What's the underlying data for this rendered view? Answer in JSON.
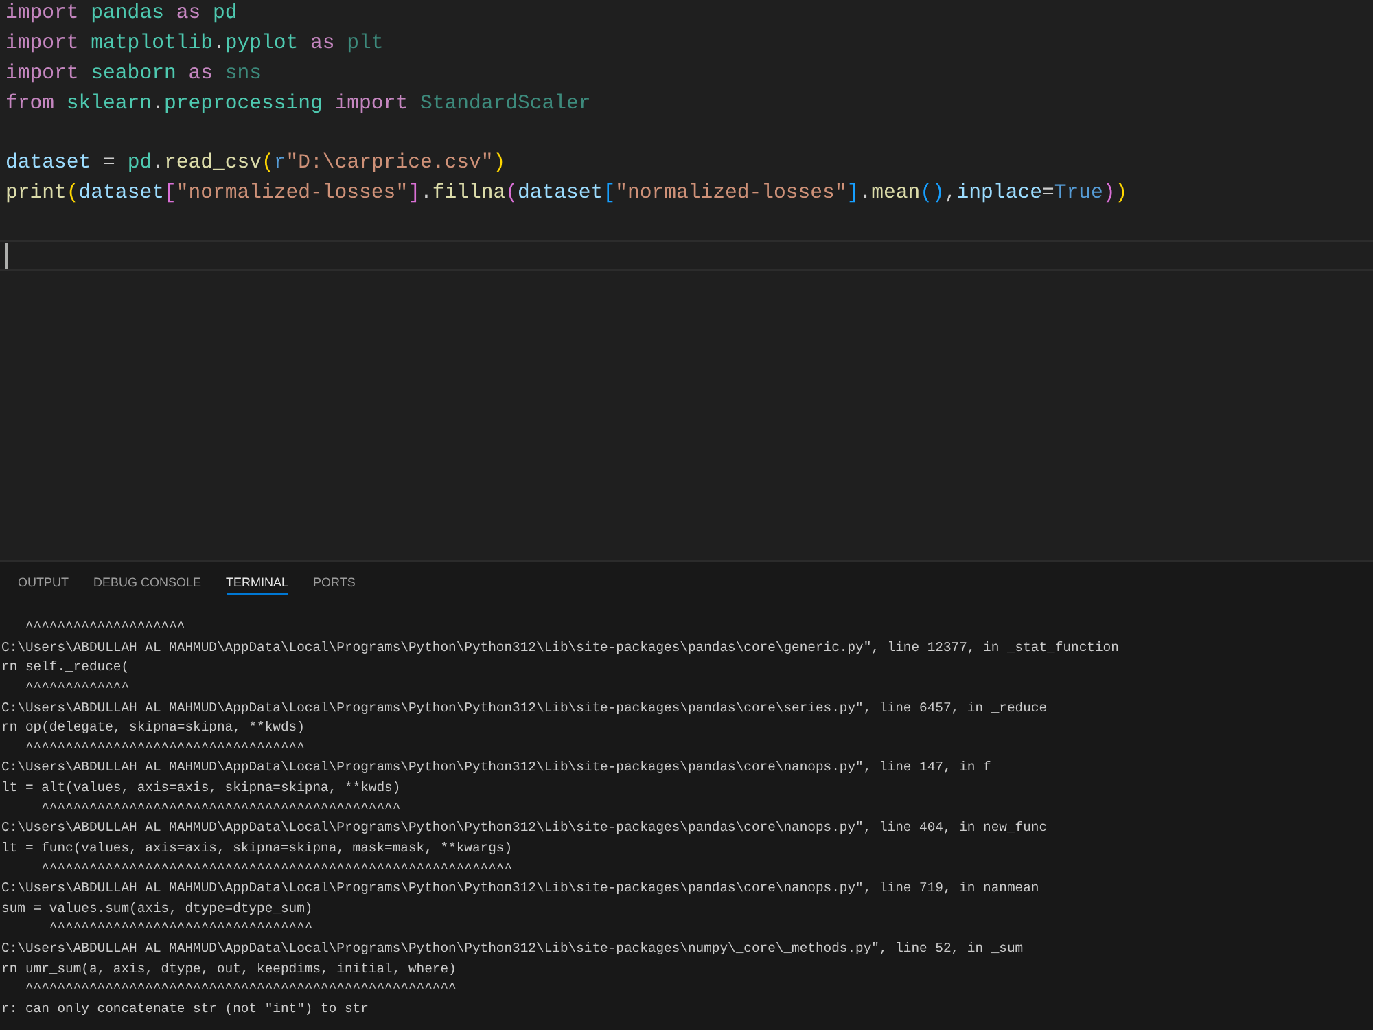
{
  "editor": {
    "lines": [
      {
        "kind": "code",
        "tokens": [
          {
            "kind": "keyword",
            "text": "import "
          },
          {
            "kind": "module",
            "text": "pandas "
          },
          {
            "kind": "keyword",
            "text": "as "
          },
          {
            "kind": "module",
            "text": "pd"
          }
        ]
      },
      {
        "kind": "code",
        "tokens": [
          {
            "kind": "keyword",
            "text": "import "
          },
          {
            "kind": "module",
            "text": "matplotlib"
          },
          {
            "kind": "plain",
            "text": "."
          },
          {
            "kind": "module",
            "text": "pyplot "
          },
          {
            "kind": "keyword",
            "text": "as "
          },
          {
            "kind": "unused",
            "text": "plt"
          }
        ]
      },
      {
        "kind": "code",
        "tokens": [
          {
            "kind": "keyword",
            "text": "import "
          },
          {
            "kind": "module",
            "text": "seaborn "
          },
          {
            "kind": "keyword",
            "text": "as "
          },
          {
            "kind": "unused",
            "text": "sns"
          }
        ]
      },
      {
        "kind": "code",
        "tokens": [
          {
            "kind": "keyword",
            "text": "from "
          },
          {
            "kind": "module",
            "text": "sklearn"
          },
          {
            "kind": "plain",
            "text": "."
          },
          {
            "kind": "module",
            "text": "preprocessing "
          },
          {
            "kind": "keyword",
            "text": "import "
          },
          {
            "kind": "unused",
            "text": "StandardScaler"
          }
        ]
      },
      {
        "kind": "blank"
      },
      {
        "kind": "code",
        "tokens": [
          {
            "kind": "variable",
            "text": "dataset"
          },
          {
            "kind": "plain",
            "text": " = "
          },
          {
            "kind": "module",
            "text": "pd"
          },
          {
            "kind": "plain",
            "text": "."
          },
          {
            "kind": "function",
            "text": "read_csv"
          },
          {
            "kind": "group",
            "open": "(",
            "close": ")",
            "children": [
              {
                "kind": "prefix",
                "text": "r"
              },
              {
                "kind": "string",
                "text": "\"D:\\carprice.csv\""
              }
            ]
          }
        ]
      },
      {
        "kind": "code",
        "tokens": [
          {
            "kind": "function",
            "text": "print"
          },
          {
            "kind": "group",
            "open": "(",
            "close": ")",
            "children": [
              {
                "kind": "variable",
                "text": "dataset"
              },
              {
                "kind": "group",
                "open": "[",
                "close": "]",
                "children": [
                  {
                    "kind": "string",
                    "text": "\"normalized-losses\""
                  }
                ]
              },
              {
                "kind": "plain",
                "text": "."
              },
              {
                "kind": "function",
                "text": "fillna"
              },
              {
                "kind": "group",
                "open": "(",
                "close": ")",
                "children": [
                  {
                    "kind": "variable",
                    "text": "dataset"
                  },
                  {
                    "kind": "group",
                    "open": "[",
                    "close": "]",
                    "children": [
                      {
                        "kind": "string",
                        "text": "\"normalized-losses\""
                      }
                    ]
                  },
                  {
                    "kind": "plain",
                    "text": "."
                  },
                  {
                    "kind": "function",
                    "text": "mean"
                  },
                  {
                    "kind": "group",
                    "open": "(",
                    "close": ")"
                  },
                  {
                    "kind": "plain",
                    "text": ","
                  },
                  {
                    "kind": "variable",
                    "text": "inplace"
                  },
                  {
                    "kind": "plain",
                    "text": "="
                  },
                  {
                    "kind": "constant",
                    "text": "True"
                  }
                ]
              }
            ]
          }
        ]
      },
      {
        "kind": "blank"
      },
      {
        "kind": "current"
      }
    ]
  },
  "panel": {
    "tabs": [
      {
        "label": "OUTPUT",
        "selected": false
      },
      {
        "label": "DEBUG CONSOLE",
        "selected": false
      },
      {
        "label": "TERMINAL",
        "selected": true
      },
      {
        "label": "PORTS",
        "selected": false
      }
    ],
    "terminal": {
      "lines": [
        "   ^^^^^^^^^^^^^^^^^^^^",
        "C:\\Users\\ABDULLAH AL MAHMUD\\AppData\\Local\\Programs\\Python\\Python312\\Lib\\site-packages\\pandas\\core\\generic.py\", line 12377, in _stat_function",
        "rn self._reduce(",
        "   ^^^^^^^^^^^^^",
        "C:\\Users\\ABDULLAH AL MAHMUD\\AppData\\Local\\Programs\\Python\\Python312\\Lib\\site-packages\\pandas\\core\\series.py\", line 6457, in _reduce",
        "rn op(delegate, skipna=skipna, **kwds)",
        "   ^^^^^^^^^^^^^^^^^^^^^^^^^^^^^^^^^^^",
        "C:\\Users\\ABDULLAH AL MAHMUD\\AppData\\Local\\Programs\\Python\\Python312\\Lib\\site-packages\\pandas\\core\\nanops.py\", line 147, in f",
        "lt = alt(values, axis=axis, skipna=skipna, **kwds)",
        "     ^^^^^^^^^^^^^^^^^^^^^^^^^^^^^^^^^^^^^^^^^^^^^",
        "C:\\Users\\ABDULLAH AL MAHMUD\\AppData\\Local\\Programs\\Python\\Python312\\Lib\\site-packages\\pandas\\core\\nanops.py\", line 404, in new_func",
        "lt = func(values, axis=axis, skipna=skipna, mask=mask, **kwargs)",
        "     ^^^^^^^^^^^^^^^^^^^^^^^^^^^^^^^^^^^^^^^^^^^^^^^^^^^^^^^^^^^",
        "C:\\Users\\ABDULLAH AL MAHMUD\\AppData\\Local\\Programs\\Python\\Python312\\Lib\\site-packages\\pandas\\core\\nanops.py\", line 719, in nanmean",
        "sum = values.sum(axis, dtype=dtype_sum)",
        "      ^^^^^^^^^^^^^^^^^^^^^^^^^^^^^^^^^",
        "C:\\Users\\ABDULLAH AL MAHMUD\\AppData\\Local\\Programs\\Python\\Python312\\Lib\\site-packages\\numpy\\_core\\_methods.py\", line 52, in _sum",
        "rn umr_sum(a, axis, dtype, out, keepdims, initial, where)",
        "   ^^^^^^^^^^^^^^^^^^^^^^^^^^^^^^^^^^^^^^^^^^^^^^^^^^^^^^",
        "r: can only concatenate str (not \"int\") to str"
      ]
    }
  }
}
